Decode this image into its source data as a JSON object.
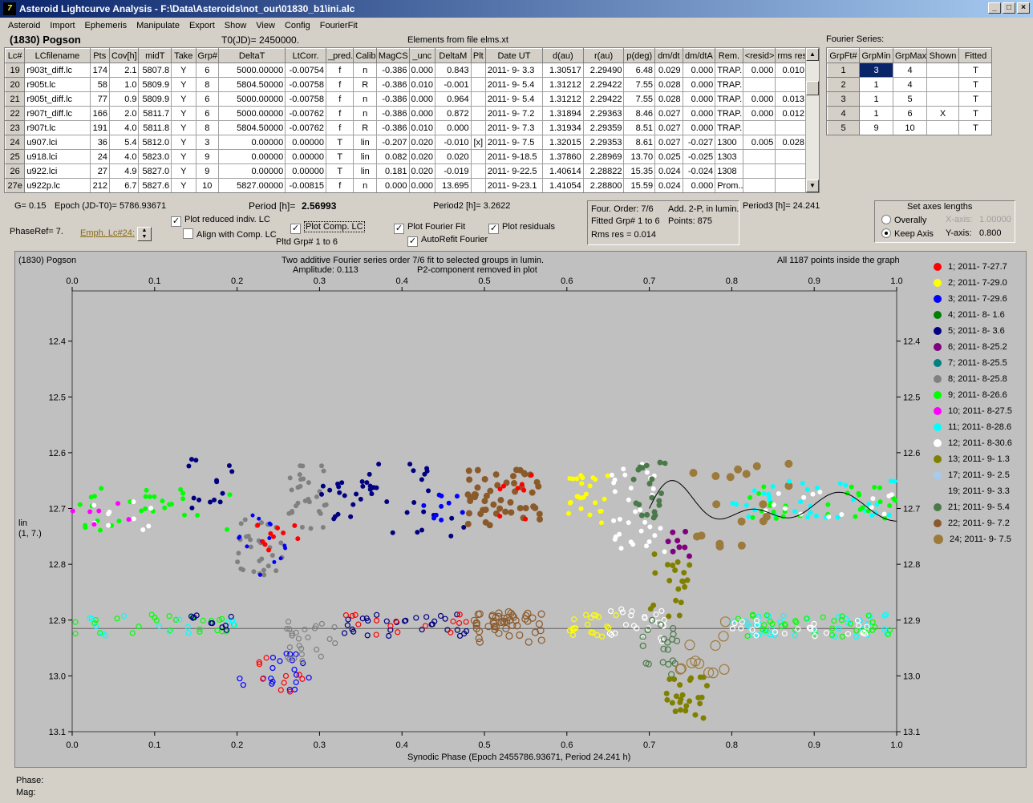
{
  "window": {
    "title": "Asteroid Lightcurve Analysis - F:\\Data\\Asteroids\\not_our\\01830_b1\\ini.alc"
  },
  "menu": [
    "Asteroid",
    "Import",
    "Ephemeris",
    "Manipulate",
    "Export",
    "Show",
    "View",
    "Config",
    "FourierFit"
  ],
  "header": {
    "asteroid": "(1830) Pogson",
    "t0": "T0(JD)= 2450000.",
    "elements": "Elements from file elms.xt",
    "fourier_label": "Fourier Series:"
  },
  "lc_table": {
    "columns": [
      "Lc#",
      "LCfilename",
      "Pts",
      "Cov[h]",
      "midT",
      "Take",
      "Grp#",
      "DeltaT",
      "LtCorr.",
      "_pred.",
      "Calib.",
      "MagCS",
      "_unc",
      "DeltaM",
      "Plt",
      "Date UT",
      "d(au)",
      "r(au)",
      "p(deg)",
      "dm/dt",
      "dm/dtA",
      "Rem.",
      "<resid>",
      "rms res"
    ],
    "rows": [
      [
        "19",
        "r903t_diff.lc",
        "174",
        "2.1",
        "5807.8",
        "Y",
        "6",
        "5000.00000",
        "-0.00754",
        "f",
        "n",
        "-0.386",
        "0.000",
        "0.843",
        "",
        "2011- 9- 3.3",
        "1.30517",
        "2.29490",
        "6.48",
        "0.029",
        "0.000",
        "TRAP.",
        "0.000",
        "0.010"
      ],
      [
        "20",
        "r905t.lc",
        "58",
        "1.0",
        "5809.9",
        "Y",
        "8",
        "5804.50000",
        "-0.00758",
        "f",
        "R",
        "-0.386",
        "0.010",
        "-0.001",
        "",
        "2011- 9- 5.4",
        "1.31212",
        "2.29422",
        "7.55",
        "0.028",
        "0.000",
        "TRAP.",
        "",
        ""
      ],
      [
        "21",
        "r905t_diff.lc",
        "77",
        "0.9",
        "5809.9",
        "Y",
        "6",
        "5000.00000",
        "-0.00758",
        "f",
        "n",
        "-0.386",
        "0.000",
        "0.964",
        "",
        "2011- 9- 5.4",
        "1.31212",
        "2.29422",
        "7.55",
        "0.028",
        "0.000",
        "TRAP.",
        "0.000",
        "0.013"
      ],
      [
        "22",
        "r907t_diff.lc",
        "166",
        "2.0",
        "5811.7",
        "Y",
        "6",
        "5000.00000",
        "-0.00762",
        "f",
        "n",
        "-0.386",
        "0.000",
        "0.872",
        "",
        "2011- 9- 7.2",
        "1.31894",
        "2.29363",
        "8.46",
        "0.027",
        "0.000",
        "TRAP.",
        "0.000",
        "0.012"
      ],
      [
        "23",
        "r907t.lc",
        "191",
        "4.0",
        "5811.8",
        "Y",
        "8",
        "5804.50000",
        "-0.00762",
        "f",
        "R",
        "-0.386",
        "0.010",
        "0.000",
        "",
        "2011- 9- 7.3",
        "1.31934",
        "2.29359",
        "8.51",
        "0.027",
        "0.000",
        "TRAP.",
        "",
        ""
      ],
      [
        "24",
        "u907.lci",
        "36",
        "5.4",
        "5812.0",
        "Y",
        "3",
        "0.00000",
        "0.00000",
        "T",
        "lin",
        "-0.207",
        "0.020",
        "-0.010",
        "[x]",
        "2011- 9- 7.5",
        "1.32015",
        "2.29353",
        "8.61",
        "0.027",
        "-0.027",
        "1300",
        "0.005",
        "0.028"
      ],
      [
        "25",
        "u918.lci",
        "24",
        "4.0",
        "5823.0",
        "Y",
        "9",
        "0.00000",
        "0.00000",
        "T",
        "lin",
        "0.082",
        "0.020",
        "0.020",
        "",
        "2011- 9-18.5",
        "1.37860",
        "2.28969",
        "13.70",
        "0.025",
        "-0.025",
        "1303",
        "",
        ""
      ],
      [
        "26",
        "u922.lci",
        "27",
        "4.9",
        "5827.0",
        "Y",
        "9",
        "0.00000",
        "0.00000",
        "T",
        "lin",
        "0.181",
        "0.020",
        "-0.019",
        "",
        "2011- 9-22.5",
        "1.40614",
        "2.28822",
        "15.35",
        "0.024",
        "-0.024",
        "1308",
        "",
        ""
      ],
      [
        "27e",
        "u922p.lc",
        "212",
        "6.7",
        "5827.6",
        "Y",
        "10",
        "5827.00000",
        "-0.00815",
        "f",
        "n",
        "0.000",
        "0.000",
        "13.695",
        "",
        "2011- 9-23.1",
        "1.41054",
        "2.28800",
        "15.59",
        "0.024",
        "0.000",
        "Prom...",
        "",
        ""
      ]
    ]
  },
  "fourier_table": {
    "columns": [
      "GrpFt#",
      "GrpMin",
      "GrpMax",
      "Shown",
      "Fitted"
    ],
    "rows": [
      [
        "1",
        "3",
        "4",
        "",
        "T"
      ],
      [
        "2",
        "1",
        "4",
        "",
        "T"
      ],
      [
        "3",
        "1",
        "5",
        "",
        "T"
      ],
      [
        "4",
        "1",
        "6",
        "X",
        "T"
      ],
      [
        "5",
        "9",
        "10",
        "",
        "T"
      ]
    ]
  },
  "info": {
    "g": "G= 0.15",
    "epoch": "Epoch (JD-T0)= 5786.93671",
    "period_label": "Period [h]=",
    "period_value": "2.56993",
    "period2": "Period2 [h]= 3.2622",
    "period3": "Period3 [h]= 24.241",
    "phaseref": "PhaseRef= 7.",
    "emph": "Emph. Lc#24:",
    "pltd_grp": "Pltd Grp#  1   to    6"
  },
  "checks": {
    "plot_reduced": "Plot reduced indiv. LC",
    "align": "Align with Comp. LC",
    "plot_comp": "Plot Comp. LC",
    "plot_fourier": "Plot Fourier Fit",
    "autorefit": "AutoRefit Fourier",
    "plot_residuals": "Plot residuals"
  },
  "fourier_info": {
    "order": "Four. Order:  7/6",
    "add": "Add. 2-P, in lumin.",
    "fitted": "Fitted Grp# 1 to 6",
    "points": "Points: 875",
    "rms": "Rms res     = 0.014"
  },
  "axes_box": {
    "title": "Set axes lengths",
    "overally": "Overally",
    "keep": "Keep Axis",
    "xaxis_label": "X-axis:",
    "xaxis_value": "1.00000",
    "yaxis_label": "Y-axis:",
    "yaxis_value": "0.800"
  },
  "plot": {
    "name": "(1830) Pogson",
    "subtitle1": "Two additive Fourier series order 7/6 fit to selected groups in lumin.",
    "subtitle2": "Amplitude: 0.113",
    "subtitle3": "P2-component removed in plot",
    "points_note": "All 1187 points inside the graph",
    "ylabel1": "lin",
    "ylabel2": "(1, 7.)",
    "xlabel": "Synodic Phase (Epoch 2455786.93671, Period 24.241 h)"
  },
  "chart_data": {
    "type": "scatter",
    "xlabel": "Synodic Phase (Epoch 2455786.93671, Period 24.241 h)",
    "xlim": [
      0.0,
      1.0
    ],
    "ylim": [
      13.1,
      12.31
    ],
    "x_ticks": [
      "0.0",
      "0.1",
      "0.2",
      "0.3",
      "0.4",
      "0.5",
      "0.6",
      "0.7",
      "0.8",
      "0.9",
      "1.0"
    ],
    "y_ticks": [
      "12.4",
      "12.5",
      "12.6",
      "12.7",
      "12.8",
      "12.9",
      "13.0",
      "13.1"
    ],
    "series": [
      {
        "name": "1; 2011- 7-27.7",
        "color": "#ff0000"
      },
      {
        "name": "2; 2011- 7-29.0",
        "color": "#ffff00"
      },
      {
        "name": "3; 2011- 7-29.6",
        "color": "#0000ff"
      },
      {
        "name": "4; 2011- 8- 1.6",
        "color": "#008000"
      },
      {
        "name": "5; 2011- 8- 3.6",
        "color": "#000080"
      },
      {
        "name": "6; 2011- 8-25.2",
        "color": "#800080"
      },
      {
        "name": "7; 2011- 8-25.5",
        "color": "#008080"
      },
      {
        "name": "8; 2011- 8-25.8",
        "color": "#808080"
      },
      {
        "name": "9; 2011- 8-26.6",
        "color": "#00ff00"
      },
      {
        "name": "10; 2011- 8-27.5",
        "color": "#ff00ff"
      },
      {
        "name": "11; 2011- 8-28.6",
        "color": "#00ffff"
      },
      {
        "name": "12; 2011- 8-30.6",
        "color": "#ffffff"
      },
      {
        "name": "13; 2011- 9- 1.3",
        "color": "#808000"
      },
      {
        "name": "17; 2011- 9- 2.5",
        "color": "#a6caf0"
      },
      {
        "name": "19; 2011- 9- 3.3",
        "color": "#c0c0c0"
      },
      {
        "name": "21; 2011- 9- 5.4",
        "color": "#4a7a4a"
      },
      {
        "name": "22; 2011- 9- 7.2",
        "color": "#8b5a2b"
      },
      {
        "name": "24; 2011- 9- 7.5",
        "color": "#9c7a3c"
      }
    ]
  },
  "status": {
    "phase": "Phase:",
    "mag": "Mag:"
  }
}
